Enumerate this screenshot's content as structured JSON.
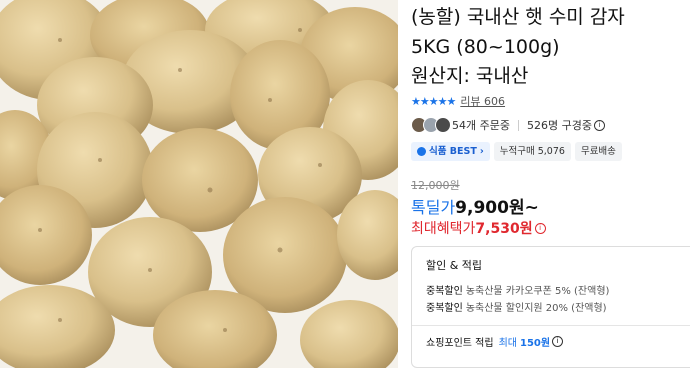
{
  "product": {
    "image_alt": "감자 사진",
    "title_lines": [
      "(농할) 국내산 햇 수미 감자",
      "5KG (80~100g)",
      "원산지: 국내산"
    ]
  },
  "rating": {
    "stars": "★★★★★",
    "review_link": "리뷰 606"
  },
  "social": {
    "orders": "54개 주문중",
    "viewers": "526명 구경중"
  },
  "tags": [
    {
      "label": "식품 BEST",
      "chevron": "›"
    },
    {
      "label": "누적구매 5,076"
    },
    {
      "label": "무료배송"
    }
  ],
  "price": {
    "original": "12,000원",
    "deal_label": "톡딜가",
    "deal_value": "9,900원~",
    "max_label": "최대혜택가",
    "max_value": "7,530원"
  },
  "benefits": {
    "title": "할인 & 적립",
    "rows": [
      {
        "label": "중복할인",
        "text": "농축산물 카카오쿠폰 5% (잔액형)"
      },
      {
        "label": "중복할인",
        "text": "농축산물 할인지원 20% (잔액형)"
      }
    ],
    "point_label": "쇼핑포인트 적립",
    "point_max": "최대",
    "point_amount": "150원"
  },
  "colors": {
    "accent": "#1a73e8",
    "sale": "#e0282f"
  }
}
